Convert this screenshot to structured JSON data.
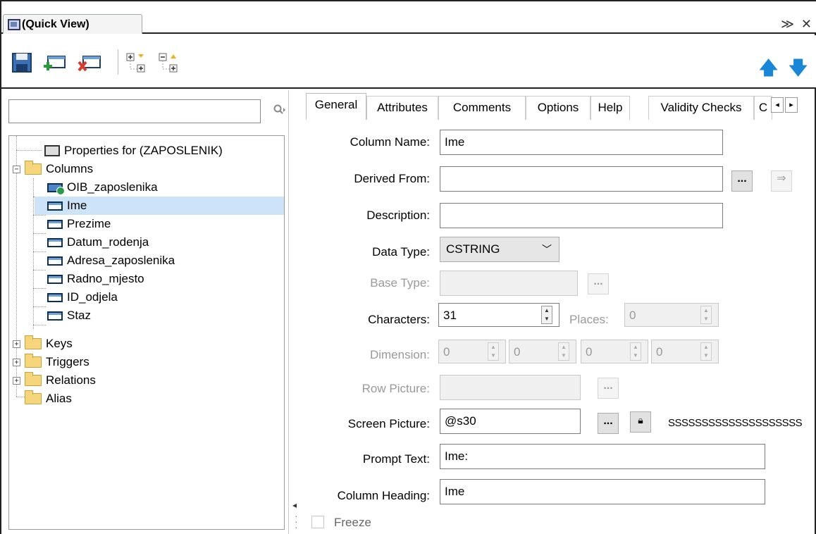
{
  "window": {
    "title": "(Quick View)",
    "ctrl_menu": "≫",
    "ctrl_close": "✕"
  },
  "toolbar": {
    "buttons": [
      "save-icon",
      "add-column-icon",
      "delete-column-icon",
      "expand-all-icon",
      "collapse-all-icon"
    ],
    "move_up": "move-up-icon",
    "move_down": "move-down-icon",
    "colors": {
      "arrows": "#1a86d8"
    }
  },
  "search": {
    "value": "",
    "placeholder": ""
  },
  "tree": {
    "root": "Properties for (ZAPOSLENIK)",
    "columns_label": "Columns",
    "columns": [
      "OIB_zaposlenika",
      "Ime",
      "Prezime",
      "Datum_rodenja",
      "Adresa_zaposlenika",
      "Radno_mjesto",
      "ID_odjela",
      "Staz"
    ],
    "selected": "Ime",
    "keys": "Keys",
    "triggers": "Triggers",
    "relations": "Relations",
    "alias": "Alias"
  },
  "tabs": [
    "General",
    "Attributes",
    "Comments",
    "Options",
    "Help",
    "Validity Checks",
    "C"
  ],
  "active_tab": "General",
  "form": {
    "column_name_label": "Column Name:",
    "column_name": "Ime",
    "derived_from_label": "Derived From:",
    "derived_from": "",
    "description_label": "Description:",
    "description": "",
    "data_type_label": "Data Type:",
    "data_type": "CSTRING",
    "base_type_label": "Base Type:",
    "base_type": "",
    "characters_label": "Characters:",
    "characters": "31",
    "places_label": "Places:",
    "places": "0",
    "dimension_label": "Dimension:",
    "dimensions": [
      "0",
      "0",
      "0",
      "0"
    ],
    "row_picture_label": "Row Picture:",
    "row_picture": "",
    "screen_picture_label": "Screen Picture:",
    "screen_picture": "@s30",
    "screen_picture_preview": "SSSSSSSSSSSSSSSSSSSS",
    "prompt_text_label": "Prompt Text:",
    "prompt_text": "Ime:",
    "column_heading_label": "Column Heading:",
    "column_heading": "Ime",
    "freeze_label": "Freeze",
    "freeze": false,
    "ellipsis": "..."
  }
}
